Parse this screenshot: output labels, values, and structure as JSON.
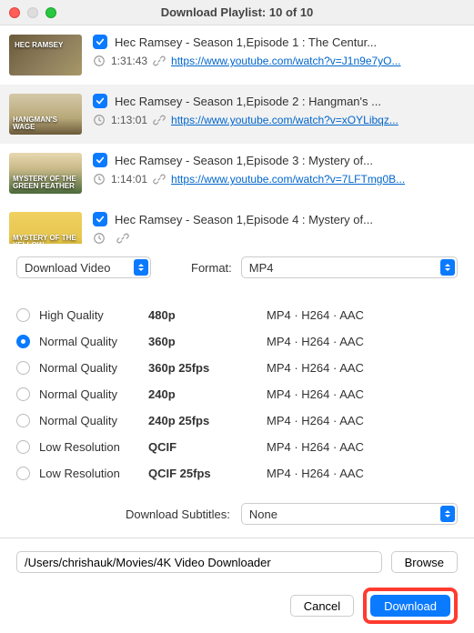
{
  "window": {
    "title": "Download Playlist: 10 of 10"
  },
  "playlist": [
    {
      "title": "Hec Ramsey - Season 1,Episode 1 : The Centur...",
      "duration": "1:31:43",
      "url": "https://www.youtube.com/watch?v=J1n9e7yO...",
      "thumb_text": "HEC RAMSEY",
      "selected": false
    },
    {
      "title": "Hec Ramsey - Season 1,Episode 2 : Hangman's ...",
      "duration": "1:13:01",
      "url": "https://www.youtube.com/watch?v=xOYLibqz...",
      "thumb_text": "HANGMAN'S WAGE",
      "selected": true
    },
    {
      "title": "Hec Ramsey - Season 1,Episode 3 : Mystery of...",
      "duration": "1:14:01",
      "url": "https://www.youtube.com/watch?v=7LFTmg0B...",
      "thumb_text": "MYSTERY OF THE GREEN FEATHER",
      "selected": false
    },
    {
      "title": "Hec Ramsey - Season 1,Episode 4 : Mystery of...",
      "duration": "",
      "url": "",
      "thumb_text": "MYSTERY OF THE YELLOW",
      "selected": false
    }
  ],
  "action_select": {
    "value": "Download Video"
  },
  "format": {
    "label": "Format:",
    "value": "MP4"
  },
  "qualities": [
    {
      "name": "High Quality",
      "res": "480p",
      "codec": "MP4 · H264 · AAC",
      "on": false
    },
    {
      "name": "Normal Quality",
      "res": "360p",
      "codec": "MP4 · H264 · AAC",
      "on": true
    },
    {
      "name": "Normal Quality",
      "res": "360p 25fps",
      "codec": "MP4 · H264 · AAC",
      "on": false
    },
    {
      "name": "Normal Quality",
      "res": "240p",
      "codec": "MP4 · H264 · AAC",
      "on": false
    },
    {
      "name": "Normal Quality",
      "res": "240p 25fps",
      "codec": "MP4 · H264 · AAC",
      "on": false
    },
    {
      "name": "Low Resolution",
      "res": "QCIF",
      "codec": "MP4 · H264 · AAC",
      "on": false
    },
    {
      "name": "Low Resolution",
      "res": "QCIF 25fps",
      "codec": "MP4 · H264 · AAC",
      "on": false
    }
  ],
  "subtitles": {
    "label": "Download Subtitles:",
    "value": "None"
  },
  "path": {
    "value": "/Users/chrishauk/Movies/4K Video Downloader"
  },
  "buttons": {
    "browse": "Browse",
    "cancel": "Cancel",
    "download": "Download"
  }
}
